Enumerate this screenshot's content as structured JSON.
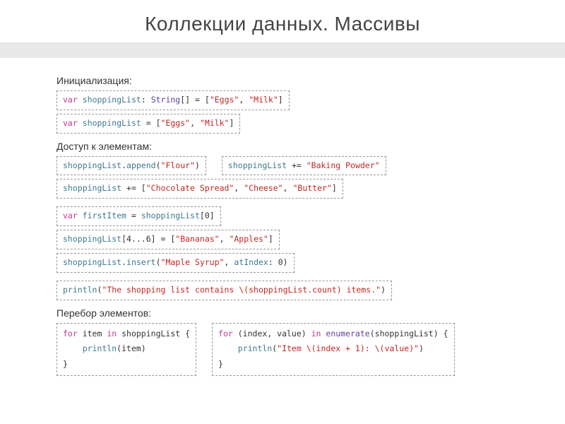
{
  "title": "Коллекции данных. Массивы",
  "sections": {
    "init": "Инициализация:",
    "access": "Доступ к элементам:",
    "iterate": "Перебор элементов:"
  },
  "code": {
    "init1": {
      "kw": "var",
      "name": "shoppingList",
      "colon": ":",
      "type": "String",
      "brackets": "[]",
      "eq": " = ",
      "lb": "[",
      "s1": "\"Eggs\"",
      "comma": ", ",
      "s2": "\"Milk\"",
      "rb": "]"
    },
    "init2": {
      "kw": "var",
      "name": "shoppingList",
      "eq": " = ",
      "lb": "[",
      "s1": "\"Eggs\"",
      "comma": ", ",
      "s2": "\"Milk\"",
      "rb": "]"
    },
    "append": {
      "name": "shoppingList",
      "dot": ".",
      "method": "append",
      "lp": "(",
      "s": "\"Flour\"",
      "rp": ")"
    },
    "plusEq1": {
      "name": "shoppingList",
      "op": " += ",
      "s": "\"Baking Powder\""
    },
    "plusEq2": {
      "name": "shoppingList",
      "op": " += ",
      "lb": "[",
      "s1": "\"Chocolate Spread\"",
      "c1": ", ",
      "s2": "\"Cheese\"",
      "c2": ", ",
      "s3": "\"Butter\"",
      "rb": "]"
    },
    "first": {
      "kw": "var",
      "name1": "firstItem",
      "eq": " = ",
      "name2": "shoppingList",
      "idx": "[0]"
    },
    "range": {
      "name": "shoppingList",
      "idx": "[4...6]",
      "eq": " = ",
      "lb": "[",
      "s1": "\"Bananas\"",
      "comma": ", ",
      "s2": "\"Apples\"",
      "rb": "]"
    },
    "insert": {
      "name": "shoppingList",
      "dot": ".",
      "method": "insert",
      "lp": "(",
      "s": "\"Maple Syrup\"",
      "comma": ", ",
      "param": "atIndex",
      "colon": ": ",
      "val": "0",
      "rp": ")"
    },
    "println": {
      "fn": "println",
      "lp": "(",
      "s": "\"The shopping list contains \\(shoppingList.count) items.\"",
      "rp": ")"
    },
    "loop1": {
      "l1a": "for",
      "l1b": " item ",
      "l1c": "in",
      "l1d": " shoppingList {",
      "l2a": "    println",
      "l2b": "(item)",
      "l3": "}"
    },
    "loop2": {
      "l1a": "for",
      "l1b": " (index, value) ",
      "l1c": "in",
      "l1d": " enumerate",
      "l1e": "(shoppingList) {",
      "l2a": "    println",
      "l2b": "(",
      "l2c": "\"Item \\(index + 1): \\(value)\"",
      "l2d": ")",
      "l3": "}"
    }
  }
}
